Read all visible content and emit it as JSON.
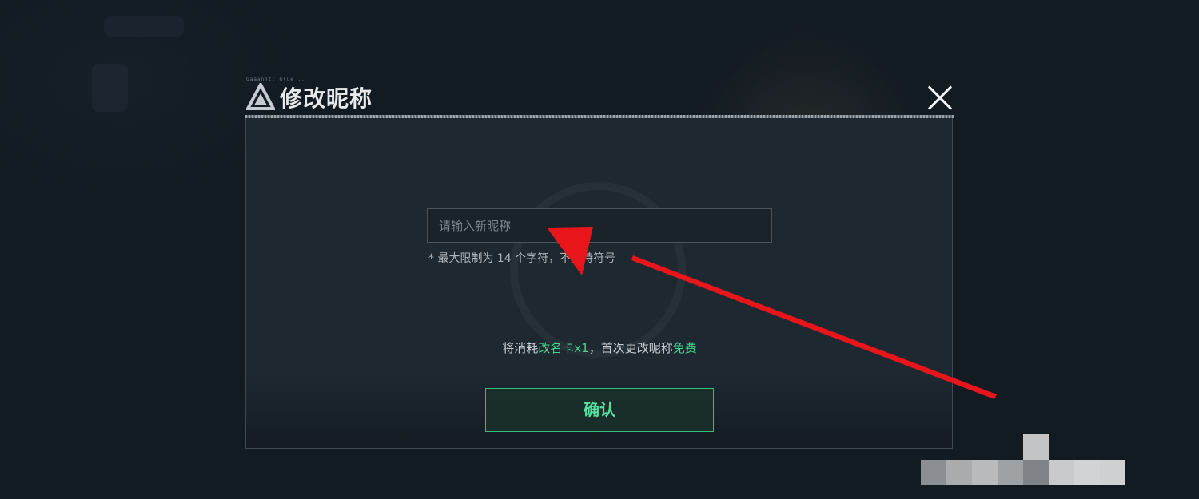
{
  "dialog": {
    "title": "修改昵称",
    "title_decor": "Gaaannt: Glue ..",
    "close_icon": "close-icon"
  },
  "nickname_input": {
    "value": "",
    "placeholder": "请输入新昵称"
  },
  "hint": "* 最大限制为 14 个字符，不支持符号",
  "cost": {
    "prefix": "将消耗",
    "item": "改名卡x1",
    "middle": "，首次更改昵称",
    "free": "免费"
  },
  "confirm_button": "确认",
  "colors": {
    "accent_green": "#3fd68d",
    "annotation_arrow": "#e8161b",
    "background": "#121a22"
  }
}
